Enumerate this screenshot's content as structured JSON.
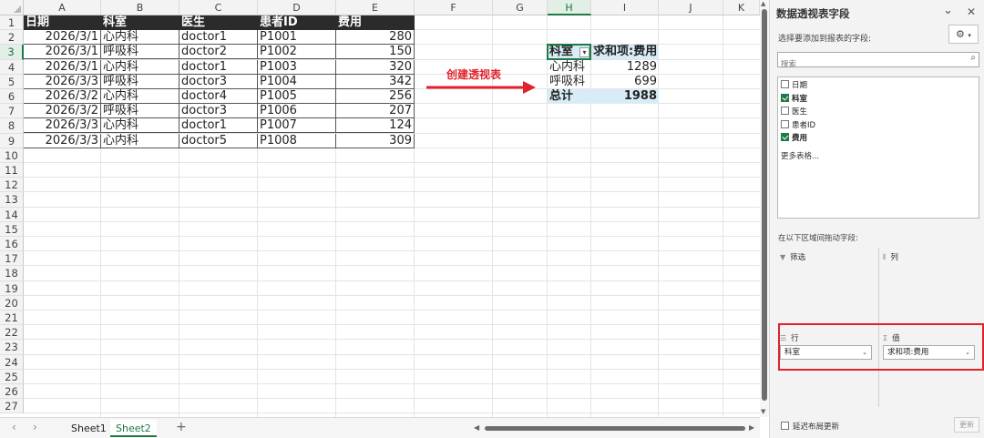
{
  "sheet": {
    "columns": [
      "A",
      "B",
      "C",
      "D",
      "E",
      "F",
      "G",
      "H",
      "I",
      "J",
      "K"
    ],
    "rows": [
      "1",
      "2",
      "3",
      "4",
      "5",
      "6",
      "7",
      "8",
      "9",
      "10",
      "11",
      "12",
      "13",
      "14",
      "15",
      "16",
      "17",
      "18",
      "19",
      "20",
      "21",
      "22",
      "23",
      "24",
      "25",
      "26",
      "27"
    ],
    "selected_column": "H",
    "selected_row": "3",
    "data_table": {
      "headers": [
        "日期",
        "科室",
        "医生",
        "患者ID",
        "费用"
      ],
      "rows": [
        [
          "2026/3/1",
          "心内科",
          "doctor1",
          "P1001",
          "280"
        ],
        [
          "2026/3/1",
          "呼吸科",
          "doctor2",
          "P1002",
          "150"
        ],
        [
          "2026/3/1",
          "心内科",
          "doctor1",
          "P1003",
          "320"
        ],
        [
          "2026/3/3",
          "呼吸科",
          "doctor3",
          "P1004",
          "342"
        ],
        [
          "2026/3/2",
          "心内科",
          "doctor4",
          "P1005",
          "256"
        ],
        [
          "2026/3/2",
          "呼吸科",
          "doctor3",
          "P1006",
          "207"
        ],
        [
          "2026/3/3",
          "心内科",
          "doctor1",
          "P1007",
          "124"
        ],
        [
          "2026/3/3",
          "心内科",
          "doctor5",
          "P1008",
          "309"
        ]
      ]
    },
    "pivot": {
      "row_header": "科室",
      "value_header": "求和项:费用",
      "rows": [
        [
          "心内科",
          "1289"
        ],
        [
          "呼吸科",
          "699"
        ]
      ],
      "total_label": "总计",
      "total_value": "1988"
    },
    "annotation": "创建透视表"
  },
  "tabs": {
    "items": [
      "Sheet1",
      "Sheet2"
    ],
    "active": "Sheet2",
    "add": "+"
  },
  "panel": {
    "title": "数据透视表字段",
    "subtitle": "选择要添加到报表的字段:",
    "search_placeholder": "搜索",
    "fields": [
      {
        "label": "日期",
        "checked": false
      },
      {
        "label": "科室",
        "checked": true
      },
      {
        "label": "医生",
        "checked": false
      },
      {
        "label": "患者ID",
        "checked": false
      },
      {
        "label": "费用",
        "checked": true
      }
    ],
    "more_tables": "更多表格...",
    "drag_hint": "在以下区域间拖动字段:",
    "areas": {
      "filter": "筛选",
      "columns": "列",
      "rows": "行",
      "values": "值",
      "rows_item": "科室",
      "values_item": "求和项:费用"
    },
    "defer_label": "延迟布局更新",
    "update_button": "更新"
  },
  "colors": {
    "accent": "#1f7a45",
    "highlight": "#e0222b",
    "pivot_fill": "#d7ecf6",
    "header_fill": "#2b2b2b"
  }
}
